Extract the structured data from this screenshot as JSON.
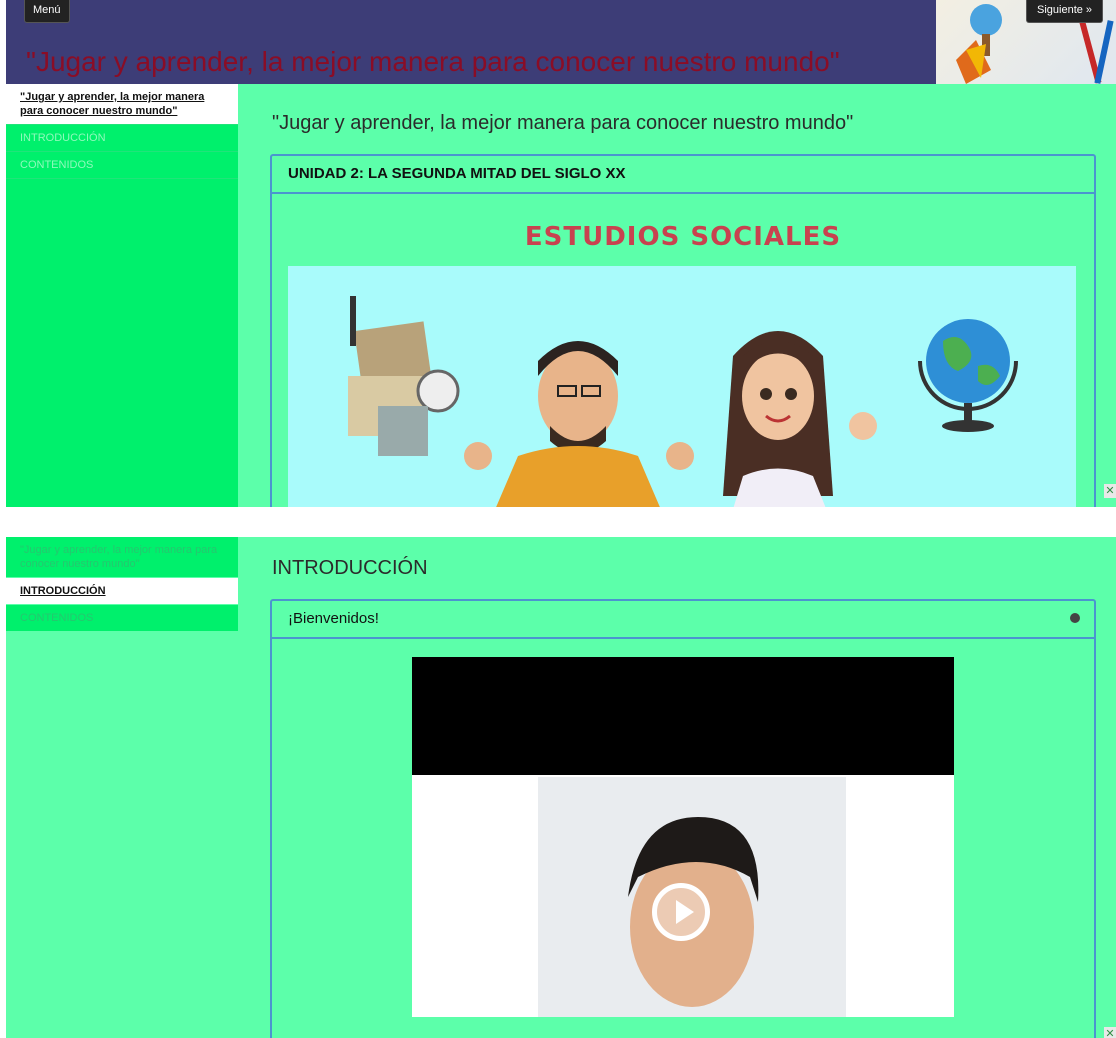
{
  "screen1": {
    "header": {
      "menu_label": "Menú",
      "title": "\"Jugar y aprender, la mejor manera para conocer nuestro mundo\"",
      "next_label": "Siguiente »"
    },
    "sidebar": {
      "items": [
        {
          "label": "\"Jugar y aprender, la mejor manera para conocer nuestro mundo\"",
          "active": true
        },
        {
          "label": "INTRODUCCIÓN",
          "active": false
        },
        {
          "label": "CONTENIDOS",
          "active": false
        }
      ]
    },
    "main": {
      "heading": "\"Jugar y aprender, la mejor manera para conocer nuestro mundo\"",
      "box_title": "UNIDAD 2: LA SEGUNDA MITAD DEL SIGLO XX",
      "subject": "ESTUDIOS SOCIALES"
    }
  },
  "screen2": {
    "sidebar": {
      "items": [
        {
          "label": "\"Jugar y aprender, la mejor manera para conocer nuestro mundo\"",
          "active": false
        },
        {
          "label": "INTRODUCCIÓN",
          "active": true
        },
        {
          "label": "CONTENIDOS",
          "active": false
        }
      ]
    },
    "main": {
      "heading": "INTRODUCCIÓN",
      "box_title": "¡Bienvenidos!"
    }
  },
  "colors": {
    "header_bg": "#3d3d77",
    "title_red": "#8a0d26",
    "sidebar_green": "#00f06c",
    "content_green": "#5cffaa",
    "box_border": "#4b95cf",
    "subject_red": "#c8424f"
  },
  "icons": {
    "collapse": "collapse-dot-icon",
    "play": "play-icon",
    "corner": "close-icon"
  }
}
